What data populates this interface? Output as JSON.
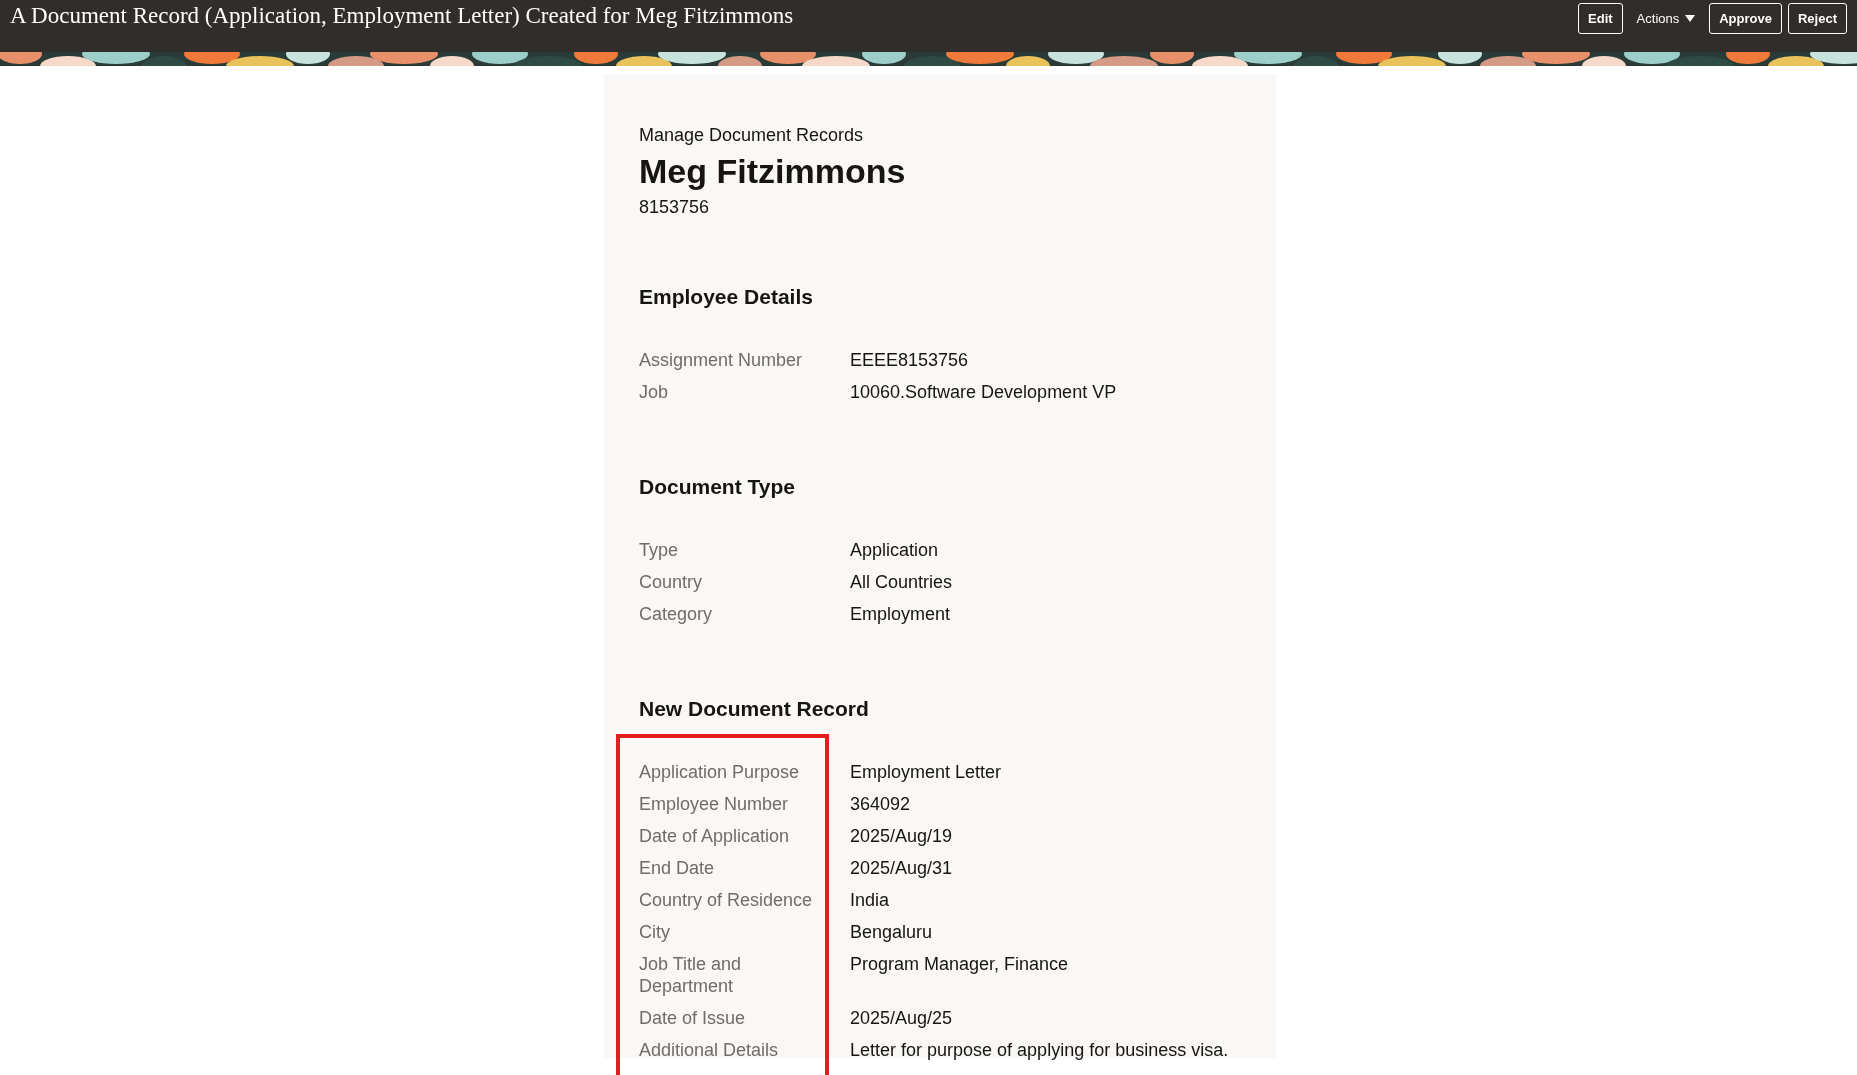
{
  "header": {
    "title": "A Document Record (Application, Employment Letter) Created for Meg Fitzimmons",
    "actions": [
      {
        "kind": "button",
        "label": "Edit"
      },
      {
        "kind": "menu",
        "label": "Actions"
      },
      {
        "kind": "button",
        "label": "Approve"
      },
      {
        "kind": "button",
        "label": "Reject"
      }
    ]
  },
  "page": {
    "breadcrumb": "Manage Document Records",
    "name": "Meg Fitzimmons",
    "person_number": "8153756"
  },
  "sections": [
    {
      "title": "Employee Details",
      "highlighted": false,
      "fields": [
        {
          "label": "Assignment Number",
          "value": "EEEE8153756"
        },
        {
          "label": "Job",
          "value": "10060.Software Development VP"
        }
      ]
    },
    {
      "title": "Document Type",
      "highlighted": false,
      "fields": [
        {
          "label": "Type",
          "value": "Application"
        },
        {
          "label": "Country",
          "value": "All Countries"
        },
        {
          "label": "Category",
          "value": "Employment"
        }
      ]
    },
    {
      "title": "New Document Record",
      "highlighted": true,
      "fields": [
        {
          "label": "Application Purpose",
          "value": "Employment Letter"
        },
        {
          "label": "Employee Number",
          "value": "364092"
        },
        {
          "label": "Date of Application",
          "value": "2025/Aug/19"
        },
        {
          "label": "End Date",
          "value": "2025/Aug/31"
        },
        {
          "label": "Country of Residence",
          "value": "India"
        },
        {
          "label": "City",
          "value": "Bengaluru"
        },
        {
          "label": "Job Title and Department",
          "value": "Program Manager, Finance"
        },
        {
          "label": "Date of Issue",
          "value": "2025/Aug/25"
        },
        {
          "label": "Additional Details",
          "value": "Letter for purpose of applying for business visa."
        }
      ]
    }
  ]
}
